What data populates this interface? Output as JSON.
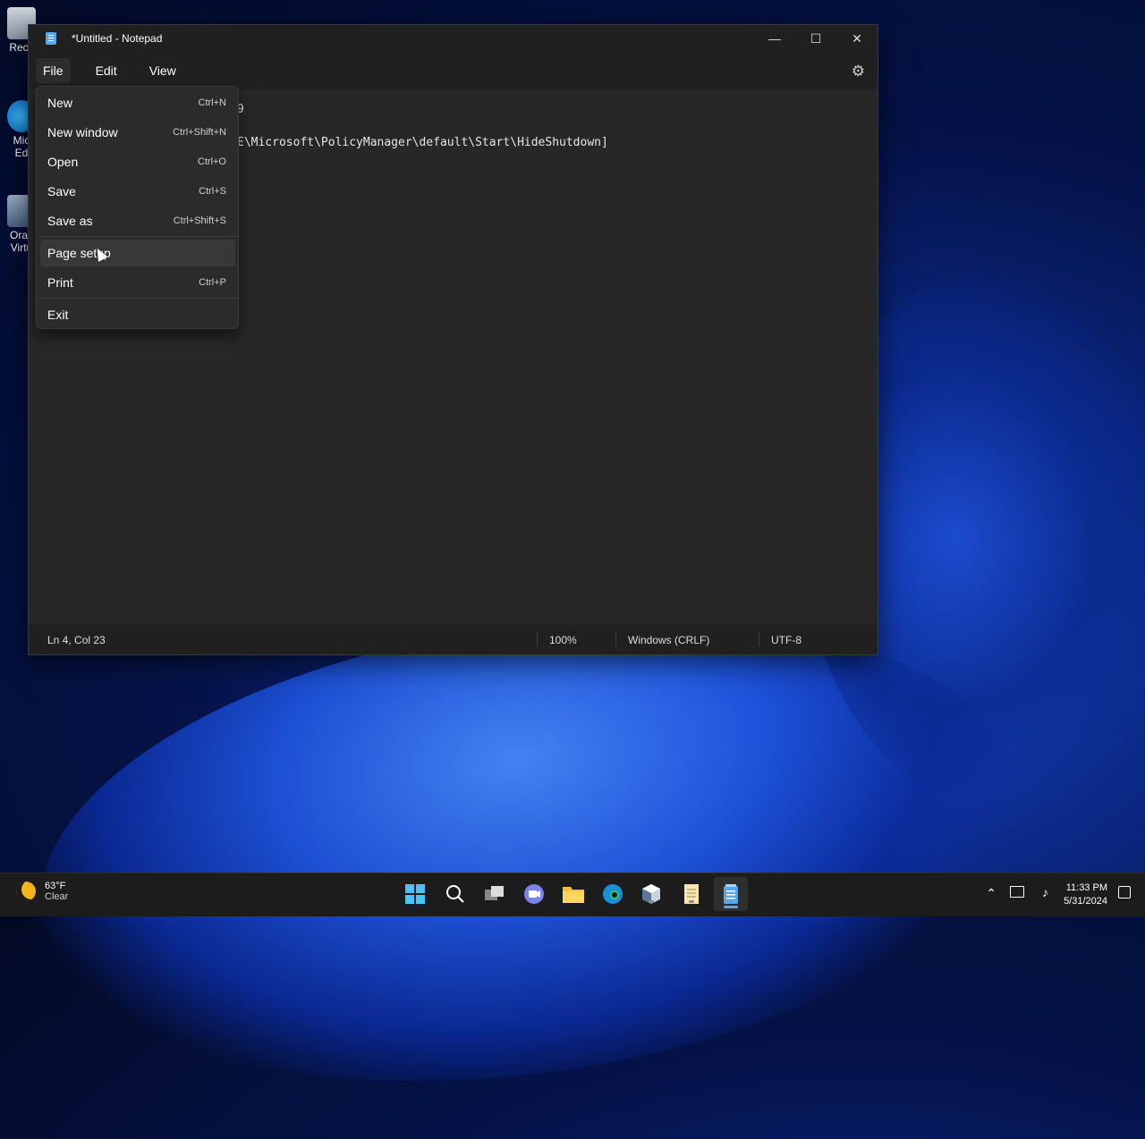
{
  "desktop": {
    "icons": [
      {
        "label": "Recy"
      },
      {
        "label": "Mic\nEd"
      },
      {
        "label": "Orac\nVirtu"
      }
    ]
  },
  "window": {
    "title": "*Untitled - Notepad",
    "controls": {
      "minimize": "—",
      "maximize": "☐",
      "close": "✕"
    },
    "menu": {
      "file": "File",
      "edit": "Edit",
      "view": "View"
    },
    "editor_lines": [
      "9",
      "E\\Microsoft\\PolicyManager\\default\\Start\\HideShutdown]"
    ],
    "status": {
      "position": "Ln 4, Col 23",
      "zoom": "100%",
      "line_ending": "Windows (CRLF)",
      "encoding": "UTF-8"
    }
  },
  "file_menu": {
    "items": [
      {
        "label": "New",
        "shortcut": "Ctrl+N"
      },
      {
        "label": "New window",
        "shortcut": "Ctrl+Shift+N"
      },
      {
        "label": "Open",
        "shortcut": "Ctrl+O"
      },
      {
        "label": "Save",
        "shortcut": "Ctrl+S"
      },
      {
        "label": "Save as",
        "shortcut": "Ctrl+Shift+S"
      },
      {
        "label": "Page setup",
        "shortcut": ""
      },
      {
        "label": "Print",
        "shortcut": "Ctrl+P"
      },
      {
        "label": "Exit",
        "shortcut": ""
      }
    ],
    "hovered": "Page setup"
  },
  "taskbar": {
    "weather": {
      "temp": "63°F",
      "condition": "Clear"
    },
    "clock": {
      "time": "11:33 PM",
      "date": "5/31/2024"
    },
    "pinned": [
      "start-icon",
      "search-icon",
      "task-view-icon",
      "chat-icon",
      "file-explorer-icon",
      "edge-icon",
      "virtualbox-icon",
      "notes-icon",
      "notepad-icon"
    ]
  },
  "colors": {
    "accent": "#5aa7e8",
    "window_bg": "#272727",
    "titlebar_bg": "#202020",
    "menu_bg": "#2b2b2b"
  }
}
